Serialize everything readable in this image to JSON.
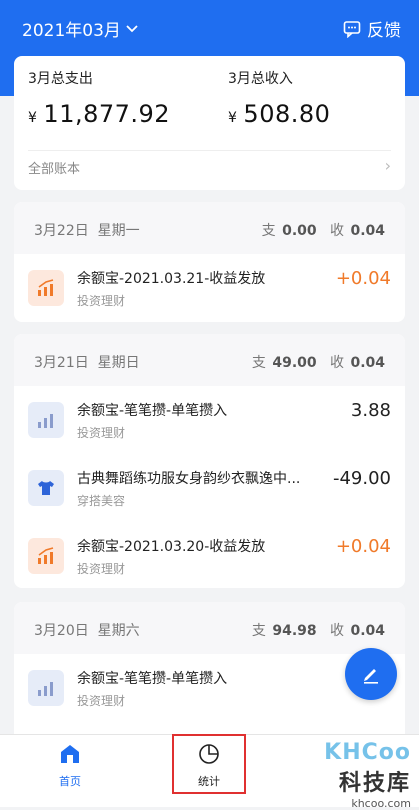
{
  "header": {
    "month": "2021年03月",
    "feedback": "反馈",
    "color": "#1f6ef0"
  },
  "summary": {
    "expense_label": "3月总支出",
    "expense_currency": "¥",
    "expense_value": "11,877.92",
    "income_label": "3月总收入",
    "income_currency": "¥",
    "income_value": "508.80",
    "all_books": "全部账本"
  },
  "days": [
    {
      "date": "3月22日",
      "weekday": "星期一",
      "out_label": "支",
      "out": "0.00",
      "in_label": "收",
      "in": "0.04",
      "items": [
        {
          "name": "余额宝-2021.03.21-收益发放",
          "category": "投资理财",
          "amount": "+0.04",
          "icon": "chart-up-icon"
        }
      ]
    },
    {
      "date": "3月21日",
      "weekday": "星期日",
      "out_label": "支",
      "out": "49.00",
      "in_label": "收",
      "in": "0.04",
      "items": [
        {
          "name": "余额宝-笔笔攒-单笔攒入",
          "category": "投资理财",
          "amount": "3.88",
          "icon": "bar-chart-icon"
        },
        {
          "name": "古典舞蹈练功服女身韵纱衣飘逸中...",
          "category": "穿搭美容",
          "amount": "-49.00",
          "icon": "shirt-icon"
        },
        {
          "name": "余额宝-2021.03.20-收益发放",
          "category": "投资理财",
          "amount": "+0.04",
          "icon": "chart-up-icon"
        }
      ]
    },
    {
      "date": "3月20日",
      "weekday": "星期六",
      "out_label": "支",
      "out": "94.98",
      "in_label": "收",
      "in": "0.04",
      "items": [
        {
          "name": "余额宝-笔笔攒-单笔攒入",
          "category": "投资理财",
          "amount": "",
          "icon": "bar-chart-icon"
        }
      ]
    }
  ],
  "tabs": {
    "home": "首页",
    "stats": "统计"
  },
  "watermark": {
    "logo": "KHCoo",
    "name": "科技库",
    "url": "khcoo.com"
  }
}
